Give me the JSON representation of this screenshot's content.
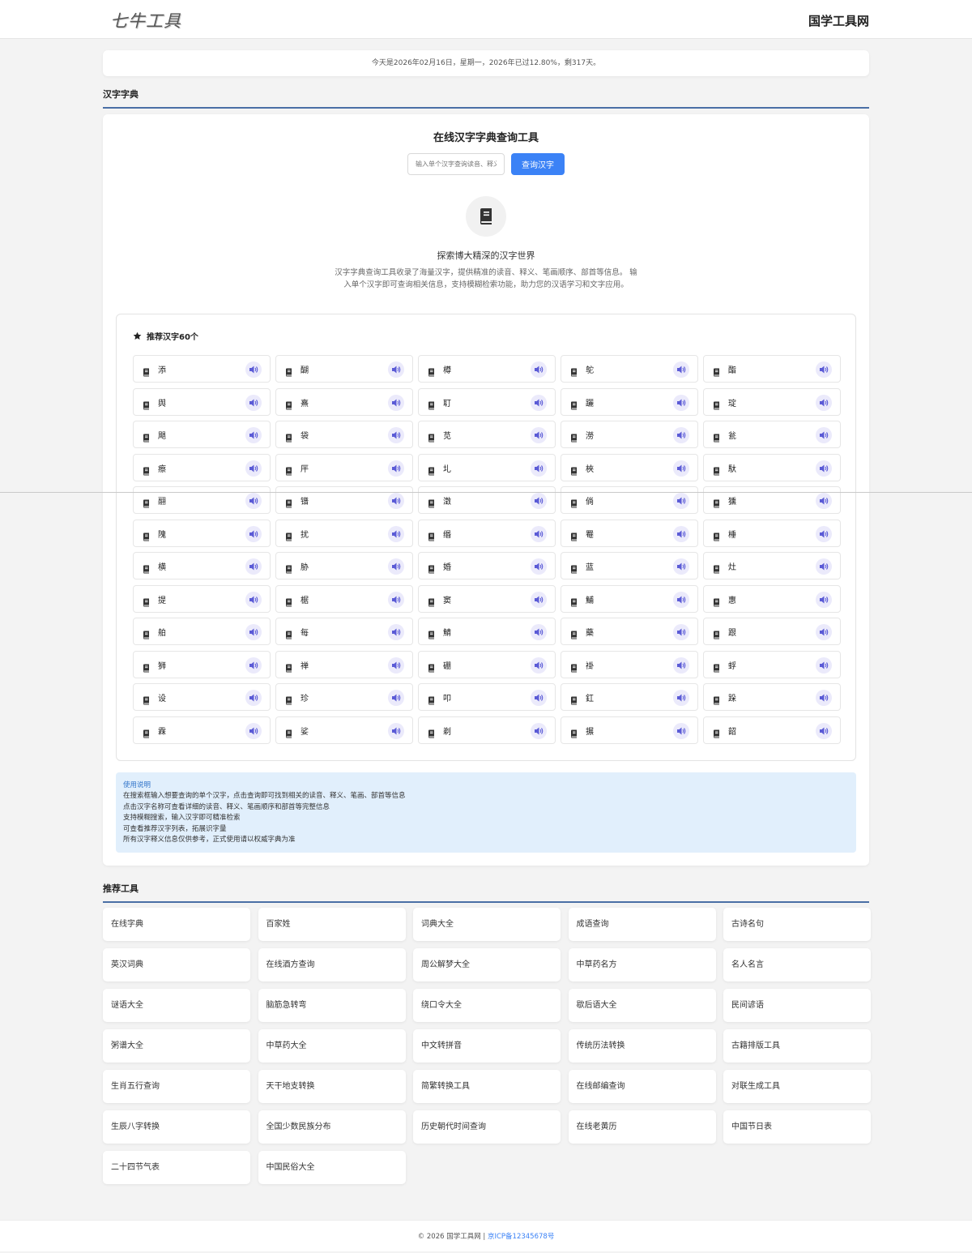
{
  "header": {
    "logo_text": "七牛工具",
    "site_name": "国学工具网"
  },
  "date_bar": {
    "text": "今天是2026年02月16日，星期一，2026年已过12.80%，剩317天。"
  },
  "dict_section": {
    "title": "汉字字典",
    "tool_title": "在线汉字字典查询工具",
    "search_placeholder": "输入单个汉字查询读音、释义",
    "search_button": "查询汉字",
    "intro_heading": "探索博大精深的汉字世界",
    "intro_text": "汉字字典查询工具收录了海量汉字，提供精准的读音、释义、笔画顺序、部首等信息。 输入单个汉字即可查询相关信息，支持模糊检索功能，助力您的汉语学习和文字应用。",
    "recommend_title": "推荐汉字60个",
    "characters": [
      "添",
      "醐",
      "樽",
      "鸵",
      "酯",
      "舆",
      "熹",
      "耵",
      "躧",
      "琔",
      "飓",
      "袋",
      "苋",
      "澇",
      "瓮",
      "瘵",
      "厈",
      "圠",
      "梜",
      "馱",
      "翮",
      "镨",
      "澂",
      "倘",
      "獯",
      "隗",
      "扰",
      "缗",
      "罨",
      "棰",
      "横",
      "胁",
      "婚",
      "蓝",
      "灶",
      "提",
      "椐",
      "窦",
      "鯆",
      "惠",
      "舶",
      "每",
      "鯖",
      "藥",
      "跟",
      "狮",
      "禅",
      "硼",
      "褂",
      "蜉",
      "设",
      "珍",
      "叩",
      "釭",
      "跺",
      "霖",
      "娑",
      "剃",
      "搌",
      "韶"
    ],
    "notes_title": "使用说明",
    "notes": [
      "在搜索框输入想要查询的单个汉字，点击查询即可找到相关的读音、释义、笔画、部首等信息",
      "点击汉字名称可查看详细的读音、释义、笔画顺序和部首等完整信息",
      "支持模糊搜索，输入汉字即可精准检索",
      "可查看推荐汉字列表，拓展识字量",
      "所有汉字释义信息仅供参考，正式使用请以权威字典为准"
    ]
  },
  "tools_section": {
    "title": "推荐工具",
    "tools": [
      "在线字典",
      "百家姓",
      "词典大全",
      "成语查询",
      "古诗名句",
      "英汉词典",
      "在线酒方查询",
      "周公解梦大全",
      "中草药名方",
      "名人名言",
      "谜语大全",
      "脑筋急转弯",
      "绕口令大全",
      "歇后语大全",
      "民间谚语",
      "粥谱大全",
      "中草药大全",
      "中文转拼音",
      "传统历法转换",
      "古籍排版工具",
      "生肖五行查询",
      "天干地支转换",
      "简繁转换工具",
      "在线邮编查询",
      "对联生成工具",
      "生辰八字转换",
      "全国少数民族分布",
      "历史朝代时间查询",
      "在线老黄历",
      "中国节日表",
      "二十四节气表",
      "中国民俗大全"
    ]
  },
  "footer": {
    "copyright": "© 2026 国学工具网 |",
    "icp": "京ICP备12345678号"
  },
  "colors": {
    "accent": "#3b82f6",
    "speaker": "#5b5bd6",
    "notes_bg": "#e1effc"
  }
}
